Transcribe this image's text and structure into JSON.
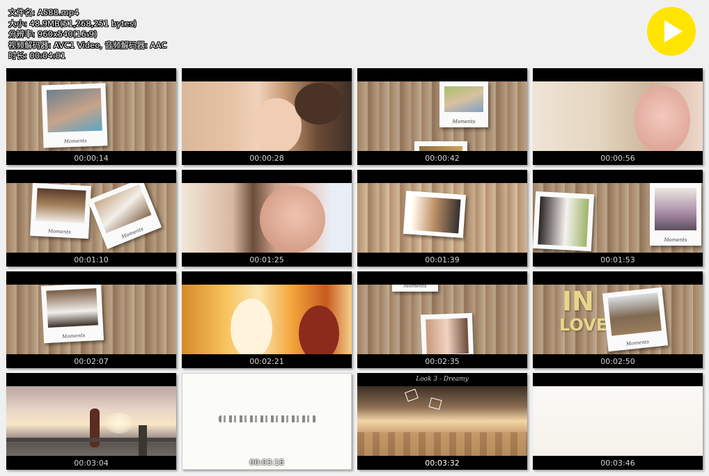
{
  "file_info": {
    "filename": "文件名: A588.mp4",
    "size": "大小: 48.9MB(51,268,251 bytes)",
    "resolution": "分辨率: 960x540(16:9)",
    "codecs": "视频解码器: AVC1 Video, 音频解码器: AAC",
    "duration": "时长: 00:04:01"
  },
  "play_button": {
    "icon": "play-icon",
    "color": "#ffe400"
  },
  "captions": {
    "moments": "Moments",
    "in": "IN",
    "love": "LOVE",
    "look": "Look 3 - Dreamy"
  },
  "thumbnails": [
    {
      "timestamp": "00:00:14"
    },
    {
      "timestamp": "00:00:28"
    },
    {
      "timestamp": "00:00:42"
    },
    {
      "timestamp": "00:00:56"
    },
    {
      "timestamp": "00:01:10"
    },
    {
      "timestamp": "00:01:25"
    },
    {
      "timestamp": "00:01:39"
    },
    {
      "timestamp": "00:01:53"
    },
    {
      "timestamp": "00:02:07"
    },
    {
      "timestamp": "00:02:21"
    },
    {
      "timestamp": "00:02:35"
    },
    {
      "timestamp": "00:02:50"
    },
    {
      "timestamp": "00:03:04"
    },
    {
      "timestamp": "00:03:18"
    },
    {
      "timestamp": "00:03:32"
    },
    {
      "timestamp": "00:03:46"
    }
  ]
}
